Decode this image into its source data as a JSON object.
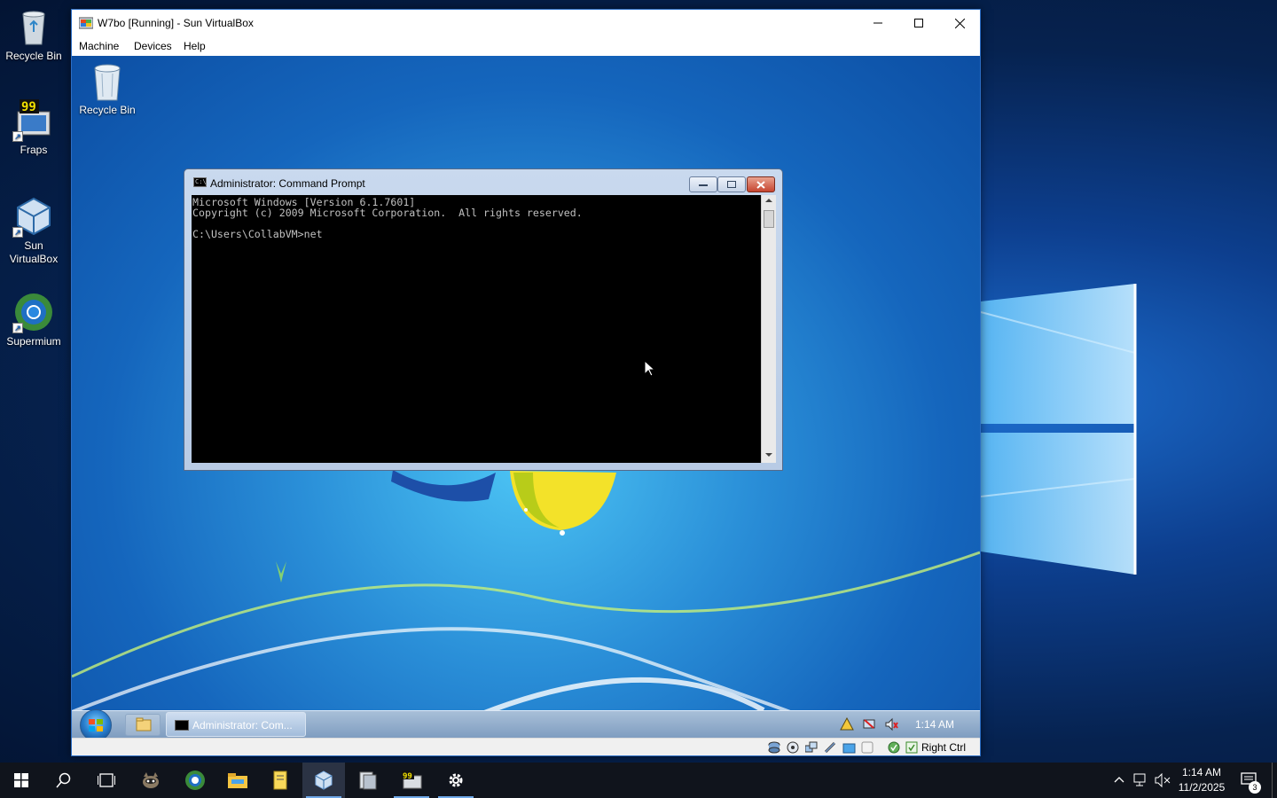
{
  "host_desktop": {
    "icons": [
      {
        "label": "Recycle Bin",
        "icon": "recycle-bin-icon"
      },
      {
        "label": "Fraps",
        "icon": "fraps-icon",
        "badge": "99"
      },
      {
        "label": "Sun VirtualBox",
        "icon": "virtualbox-icon"
      },
      {
        "label": "Supermium",
        "icon": "supermium-icon"
      }
    ]
  },
  "vbox": {
    "title": "W7bo [Running] - Sun VirtualBox",
    "menu": [
      "Machine",
      "Devices",
      "Help"
    ],
    "status_host_key": "Right Ctrl"
  },
  "guest": {
    "recycle_bin_label": "Recycle Bin",
    "cmd": {
      "title": "Administrator: Command Prompt",
      "lines": [
        "Microsoft Windows [Version 6.1.7601]",
        "Copyright (c) 2009 Microsoft Corporation.  All rights reserved.",
        "",
        "C:\\Users\\CollabVM>net"
      ]
    },
    "taskbar": {
      "task_label": "Administrator: Com...",
      "clock": "1:14 AM"
    }
  },
  "host_taskbar": {
    "time": "1:14 AM",
    "date": "11/2/2025",
    "notification_count": "3"
  },
  "colors": {
    "host_accent": "#6fa8e8",
    "console_bg": "#000000",
    "console_text": "#c0c0c0"
  }
}
